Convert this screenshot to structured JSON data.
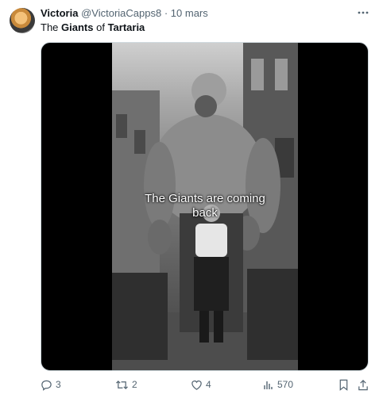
{
  "author": {
    "name": "Victoria",
    "handle": "@VictoriaCapps8",
    "separator": "·",
    "date": "10 mars"
  },
  "tweet": {
    "text_parts": [
      "The ",
      "Giants",
      " of ",
      "Tartaria"
    ]
  },
  "media": {
    "overlay_line1": "The Giants are coming",
    "overlay_line2": "back"
  },
  "actions": {
    "replies": "3",
    "reposts": "2",
    "likes": "4",
    "views": "570"
  },
  "icons": [
    "more-icon",
    "reply-icon",
    "repost-icon",
    "like-icon",
    "views-icon",
    "bookmark-icon",
    "share-icon"
  ]
}
